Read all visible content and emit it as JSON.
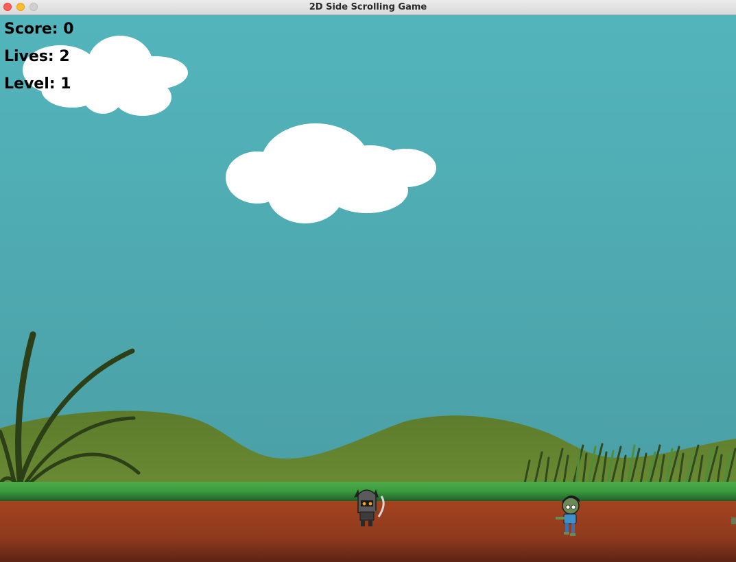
{
  "window": {
    "title": "2D Side Scrolling Game"
  },
  "hud": {
    "score_label": "Score: 0",
    "lives_label": "Lives: 2",
    "level_label": "Level: 1"
  },
  "colors": {
    "sky_top": "#52b3ba",
    "sky_bottom": "#499ba0",
    "hill": "#5a7a2c",
    "grass": "#3e9b3e",
    "dirt": "#9a3d1f"
  }
}
